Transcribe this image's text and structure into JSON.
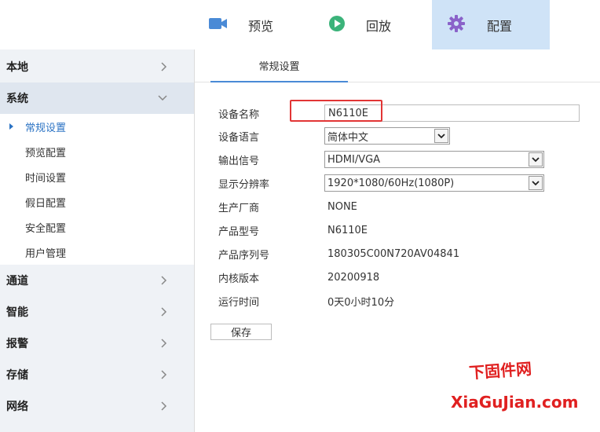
{
  "topnav": {
    "items": [
      {
        "label": "预览",
        "icon": "video-camera-icon"
      },
      {
        "label": "回放",
        "icon": "play-circle-icon"
      },
      {
        "label": "配置",
        "icon": "gear-icon"
      }
    ],
    "active": "配置"
  },
  "sidebar": {
    "categories": [
      {
        "label": "本地"
      },
      {
        "label": "系统",
        "expanded": true
      },
      {
        "label": "通道"
      },
      {
        "label": "智能"
      },
      {
        "label": "报警"
      },
      {
        "label": "存储"
      },
      {
        "label": "网络"
      }
    ],
    "system_items": [
      {
        "label": "常规设置",
        "active": true
      },
      {
        "label": "预览配置"
      },
      {
        "label": "时间设置"
      },
      {
        "label": "假日配置"
      },
      {
        "label": "安全配置"
      },
      {
        "label": "用户管理"
      }
    ]
  },
  "tabs": [
    {
      "label": "常规设置",
      "active": true
    }
  ],
  "form": {
    "device_name": {
      "label": "设备名称",
      "value": "N6110E"
    },
    "language": {
      "label": "设备语言",
      "value": "简体中文"
    },
    "output": {
      "label": "输出信号",
      "value": "HDMI/VGA"
    },
    "resolution": {
      "label": "显示分辨率",
      "value": "1920*1080/60Hz(1080P)"
    },
    "manufacturer": {
      "label": "生产厂商",
      "value": "NONE"
    },
    "model": {
      "label": "产品型号",
      "value": "N6110E"
    },
    "serial": {
      "label": "产品序列号",
      "value": "180305C00N720AV04841"
    },
    "kernel": {
      "label": "内核版本",
      "value": "20200918"
    },
    "uptime": {
      "label": "运行时间",
      "value": "0天0小时10分"
    }
  },
  "save_label": "保存",
  "watermark": {
    "cn": "下固件网",
    "en": "XiaGuJian.com"
  },
  "colors": {
    "accent": "#2b73c4",
    "config_tab_bg": "#cfe3f7",
    "sidebar_bg": "#eff2f6",
    "highlight": "#e23535",
    "watermark": "#e02020"
  }
}
